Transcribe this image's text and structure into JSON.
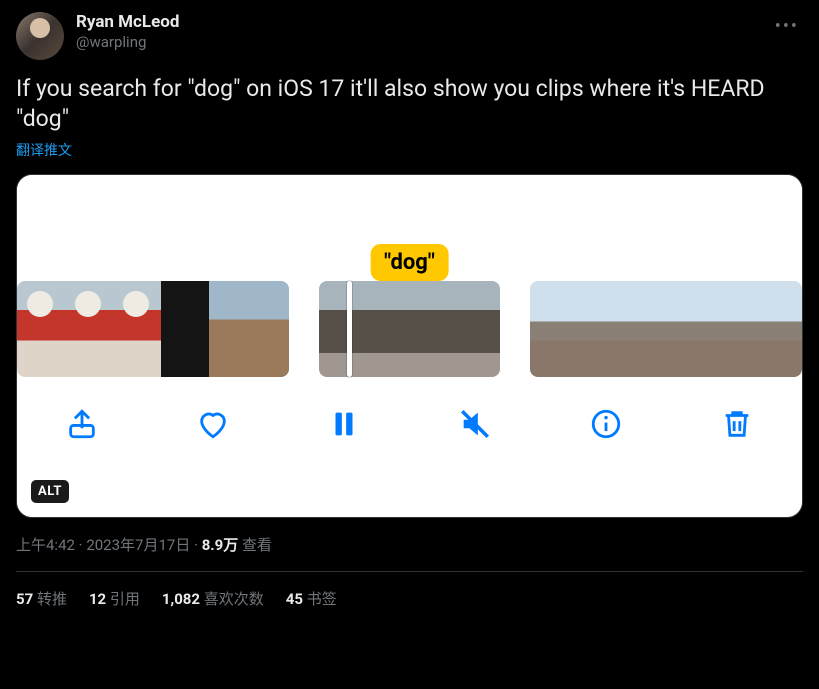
{
  "author": {
    "display_name": "Ryan McLeod",
    "handle": "@warpling"
  },
  "tweet_text": "If you search for \"dog\" on iOS 17 it'll also show you clips where it's HEARD \"dog\"",
  "translate_label": "翻译推文",
  "media": {
    "search_term": "\"dog\"",
    "alt_badge": "ALT",
    "toolbar": {
      "share": "share-icon",
      "like": "heart-icon",
      "pause": "pause-icon",
      "mute": "mute-icon",
      "info": "info-icon",
      "trash": "trash-icon"
    }
  },
  "meta": {
    "time": "上午4:42",
    "date": "2023年7月17日",
    "dot": " · ",
    "views_count": "8.9万",
    "views_label": " 查看"
  },
  "stats": {
    "retweets_count": "57",
    "retweets_label": " 转推",
    "quotes_count": "12",
    "quotes_label": " 引用",
    "likes_count": "1,082",
    "likes_label": " 喜欢次数",
    "bookmarks_count": "45",
    "bookmarks_label": " 书签"
  }
}
